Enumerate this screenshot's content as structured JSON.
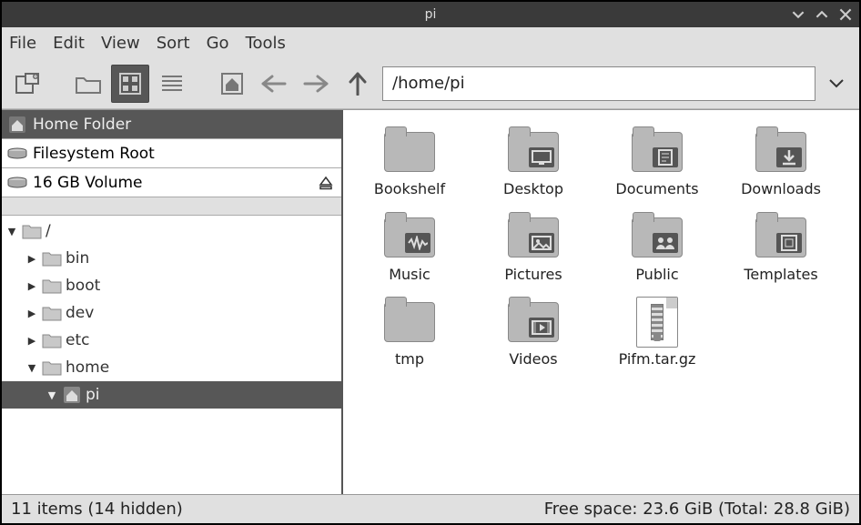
{
  "window": {
    "title": "pi"
  },
  "menubar": [
    "File",
    "Edit",
    "View",
    "Sort",
    "Go",
    "Tools"
  ],
  "toolbar": {
    "path": "/home/pi",
    "view_mode_active": "icon"
  },
  "places": [
    {
      "id": "home",
      "label": "Home Folder",
      "icon": "home-icon",
      "selected": true
    },
    {
      "id": "root",
      "label": "Filesystem Root",
      "icon": "drive-icon",
      "selected": false
    },
    {
      "id": "vol16",
      "label": "16 GB Volume",
      "icon": "drive-icon",
      "selected": false,
      "ejectable": true
    }
  ],
  "tree": [
    {
      "depth": 0,
      "label": "/",
      "icon": "folder-icon",
      "expanded": true,
      "selected": false
    },
    {
      "depth": 1,
      "label": "bin",
      "icon": "folder-icon",
      "expanded": false,
      "selected": false,
      "has_children": true
    },
    {
      "depth": 1,
      "label": "boot",
      "icon": "folder-icon",
      "expanded": false,
      "selected": false,
      "has_children": true
    },
    {
      "depth": 1,
      "label": "dev",
      "icon": "folder-icon",
      "expanded": false,
      "selected": false,
      "has_children": true
    },
    {
      "depth": 1,
      "label": "etc",
      "icon": "folder-icon",
      "expanded": false,
      "selected": false,
      "has_children": true
    },
    {
      "depth": 1,
      "label": "home",
      "icon": "folder-icon",
      "expanded": true,
      "selected": false
    },
    {
      "depth": 2,
      "label": "pi",
      "icon": "home-icon",
      "expanded": true,
      "selected": true
    }
  ],
  "items": [
    {
      "name": "Bookshelf",
      "type": "folder",
      "badge": null
    },
    {
      "name": "Desktop",
      "type": "folder",
      "badge": "desktop"
    },
    {
      "name": "Documents",
      "type": "folder",
      "badge": "doc"
    },
    {
      "name": "Downloads",
      "type": "folder",
      "badge": "download"
    },
    {
      "name": "Music",
      "type": "folder",
      "badge": "music"
    },
    {
      "name": "Pictures",
      "type": "folder",
      "badge": "picture"
    },
    {
      "name": "Public",
      "type": "folder",
      "badge": "public"
    },
    {
      "name": "Templates",
      "type": "folder",
      "badge": "template"
    },
    {
      "name": "tmp",
      "type": "folder",
      "badge": null
    },
    {
      "name": "Videos",
      "type": "folder",
      "badge": "video"
    },
    {
      "name": "Pifm.tar.gz",
      "type": "archive",
      "badge": null
    }
  ],
  "statusbar": {
    "left": "11 items (14 hidden)",
    "right": "Free space: 23.6 GiB (Total: 28.8 GiB)"
  }
}
